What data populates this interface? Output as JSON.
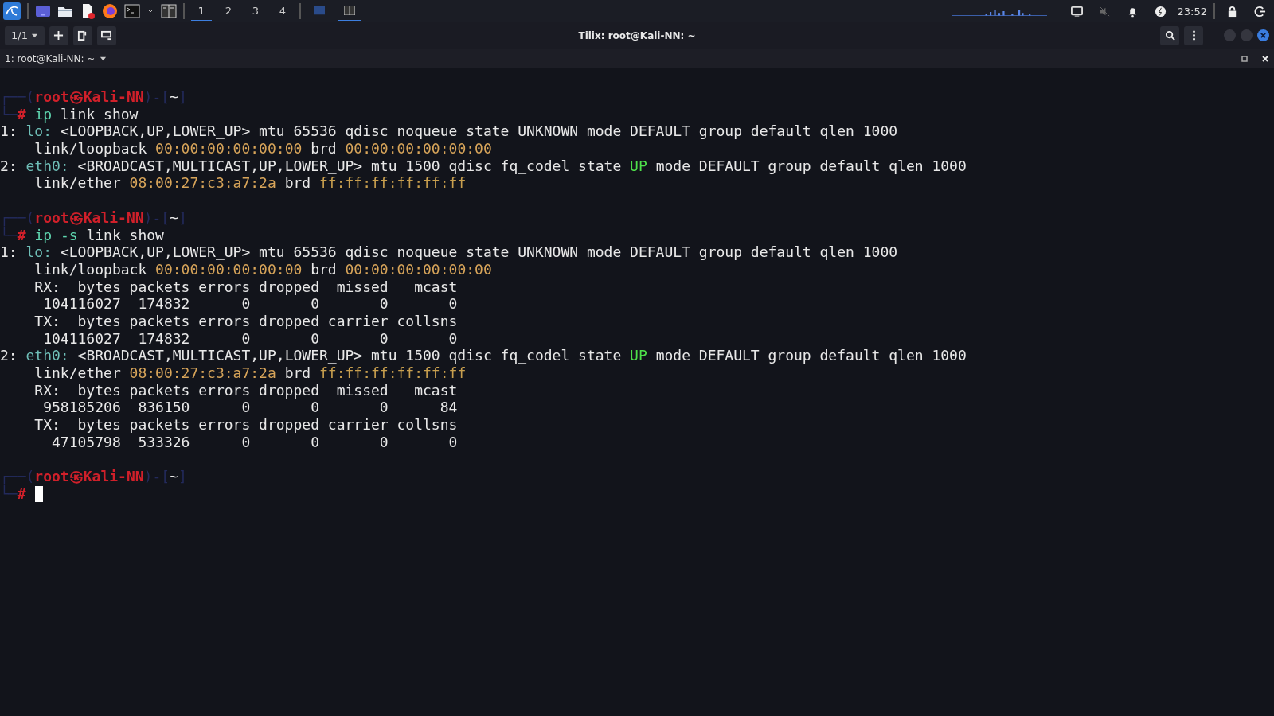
{
  "taskbar": {
    "workspaces": [
      {
        "label": "1",
        "selected": true
      },
      {
        "label": "2",
        "selected": false
      },
      {
        "label": "3",
        "selected": false
      },
      {
        "label": "4",
        "selected": false
      }
    ],
    "windows": [
      {
        "selected": false
      },
      {
        "selected": true
      }
    ],
    "clock": "23:52"
  },
  "window": {
    "title": "Tilix: root@Kali-NN: ~",
    "session_selector": "1/1"
  },
  "session": {
    "title": "1: root@Kali-NN: ~"
  },
  "terminal": {
    "lines": [
      {
        "segments": [
          {
            "text": "┌──(",
            "kind": "frame"
          },
          {
            "text": "root㉿Kali-NN",
            "kind": "user"
          },
          {
            "text": ")-[",
            "kind": "frame"
          },
          {
            "text": "~",
            "kind": "plain"
          },
          {
            "text": "]",
            "kind": "frame"
          }
        ]
      },
      {
        "segments": [
          {
            "text": "└─",
            "kind": "frame"
          },
          {
            "text": "# ",
            "kind": "hash"
          },
          {
            "text": "ip",
            "kind": "cmd"
          },
          {
            "text": " link show",
            "kind": "plain"
          }
        ]
      },
      {
        "segments": [
          {
            "text": "1: ",
            "kind": "plain"
          },
          {
            "text": "lo: ",
            "kind": "iface"
          },
          {
            "text": "<LOOPBACK,UP,LOWER_UP> mtu 65536 qdisc noqueue state UNKNOWN mode DEFAULT group default qlen 1000",
            "kind": "plain"
          }
        ]
      },
      {
        "segments": [
          {
            "text": "    link/loopback ",
            "kind": "plain"
          },
          {
            "text": "00:00:00:00:00:00",
            "kind": "mac"
          },
          {
            "text": " brd ",
            "kind": "plain"
          },
          {
            "text": "00:00:00:00:00:00",
            "kind": "mac"
          }
        ]
      },
      {
        "segments": [
          {
            "text": "2: ",
            "kind": "plain"
          },
          {
            "text": "eth0: ",
            "kind": "iface"
          },
          {
            "text": "<BROADCAST,MULTICAST,UP,LOWER_UP> mtu 1500 qdisc fq_codel state ",
            "kind": "plain"
          },
          {
            "text": "UP",
            "kind": "up"
          },
          {
            "text": " mode DEFAULT group default qlen 1000",
            "kind": "plain"
          }
        ]
      },
      {
        "segments": [
          {
            "text": "    link/ether ",
            "kind": "plain"
          },
          {
            "text": "08:00:27:c3:a7:2a",
            "kind": "mac"
          },
          {
            "text": " brd ",
            "kind": "plain"
          },
          {
            "text": "ff:ff:ff:ff:ff:ff",
            "kind": "bcast"
          }
        ]
      },
      {
        "blank_before": true,
        "segments": [
          {
            "text": "┌──(",
            "kind": "frame"
          },
          {
            "text": "root㉿Kali-NN",
            "kind": "user"
          },
          {
            "text": ")-[",
            "kind": "frame"
          },
          {
            "text": "~",
            "kind": "plain"
          },
          {
            "text": "]",
            "kind": "frame"
          }
        ]
      },
      {
        "segments": [
          {
            "text": "└─",
            "kind": "frame"
          },
          {
            "text": "# ",
            "kind": "hash"
          },
          {
            "text": "ip",
            "kind": "cmd"
          },
          {
            "text": " -s",
            "kind": "cmd"
          },
          {
            "text": " link show",
            "kind": "plain"
          }
        ]
      },
      {
        "segments": [
          {
            "text": "1: ",
            "kind": "plain"
          },
          {
            "text": "lo: ",
            "kind": "iface"
          },
          {
            "text": "<LOOPBACK,UP,LOWER_UP> mtu 65536 qdisc noqueue state UNKNOWN mode DEFAULT group default qlen 1000",
            "kind": "plain"
          }
        ]
      },
      {
        "segments": [
          {
            "text": "    link/loopback ",
            "kind": "plain"
          },
          {
            "text": "00:00:00:00:00:00",
            "kind": "mac"
          },
          {
            "text": " brd ",
            "kind": "plain"
          },
          {
            "text": "00:00:00:00:00:00",
            "kind": "mac"
          }
        ]
      },
      {
        "segments": [
          {
            "text": "    RX:  bytes packets errors dropped  missed   mcast",
            "kind": "plain"
          }
        ]
      },
      {
        "segments": [
          {
            "text": "     104116027  174832      0       0       0       0",
            "kind": "plain"
          }
        ]
      },
      {
        "segments": [
          {
            "text": "    TX:  bytes packets errors dropped carrier collsns",
            "kind": "plain"
          }
        ]
      },
      {
        "segments": [
          {
            "text": "     104116027  174832      0       0       0       0",
            "kind": "plain"
          }
        ]
      },
      {
        "segments": [
          {
            "text": "2: ",
            "kind": "plain"
          },
          {
            "text": "eth0: ",
            "kind": "iface"
          },
          {
            "text": "<BROADCAST,MULTICAST,UP,LOWER_UP> mtu 1500 qdisc fq_codel state ",
            "kind": "plain"
          },
          {
            "text": "UP",
            "kind": "up"
          },
          {
            "text": " mode DEFAULT group default qlen 1000",
            "kind": "plain"
          }
        ]
      },
      {
        "segments": [
          {
            "text": "    link/ether ",
            "kind": "plain"
          },
          {
            "text": "08:00:27:c3:a7:2a",
            "kind": "mac"
          },
          {
            "text": " brd ",
            "kind": "plain"
          },
          {
            "text": "ff:ff:ff:ff:ff:ff",
            "kind": "bcast"
          }
        ]
      },
      {
        "segments": [
          {
            "text": "    RX:  bytes packets errors dropped  missed   mcast",
            "kind": "plain"
          }
        ]
      },
      {
        "segments": [
          {
            "text": "     958185206  836150      0       0       0      84",
            "kind": "plain"
          }
        ]
      },
      {
        "segments": [
          {
            "text": "    TX:  bytes packets errors dropped carrier collsns",
            "kind": "plain"
          }
        ]
      },
      {
        "segments": [
          {
            "text": "      47105798  533326      0       0       0       0",
            "kind": "plain"
          }
        ]
      },
      {
        "blank_before": true,
        "segments": [
          {
            "text": "┌──(",
            "kind": "frame"
          },
          {
            "text": "root㉿Kali-NN",
            "kind": "user"
          },
          {
            "text": ")-[",
            "kind": "frame"
          },
          {
            "text": "~",
            "kind": "plain"
          },
          {
            "text": "]",
            "kind": "frame"
          }
        ]
      },
      {
        "segments": [
          {
            "text": "└─",
            "kind": "frame"
          },
          {
            "text": "#",
            "kind": "hash"
          }
        ],
        "cursor": true
      }
    ]
  }
}
